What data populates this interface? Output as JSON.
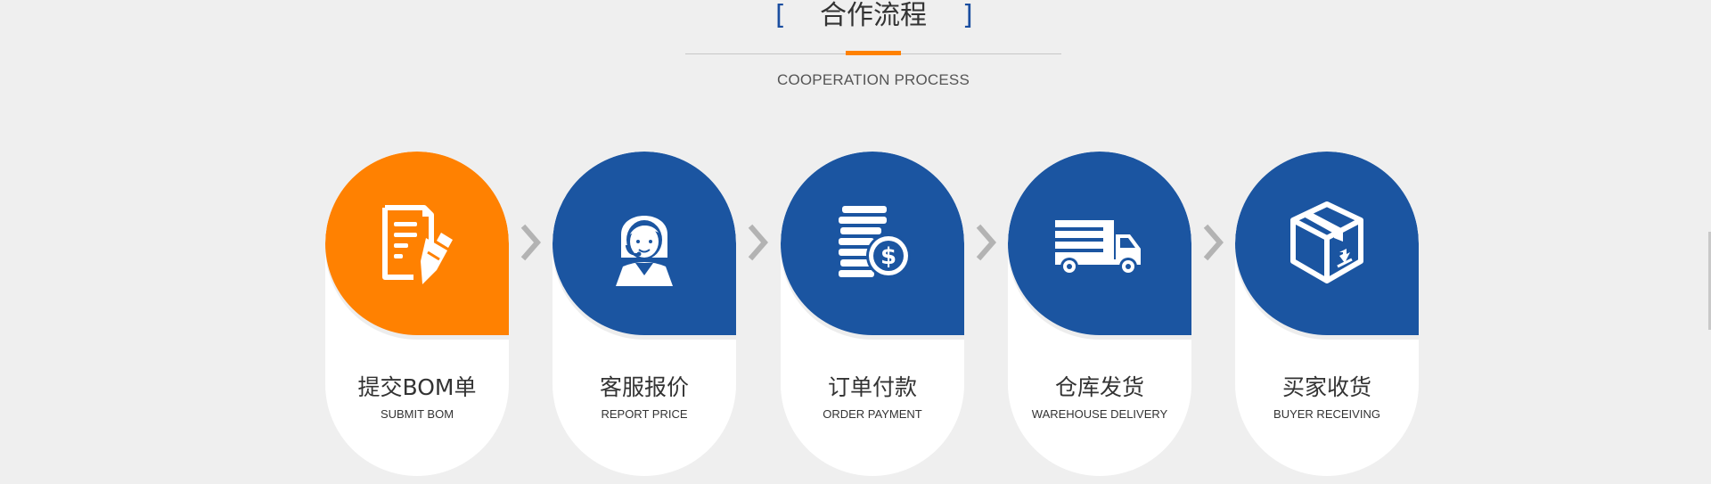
{
  "header": {
    "bracket_left": "[",
    "title": "合作流程",
    "bracket_right": "]",
    "subtitle": "COOPERATION PROCESS"
  },
  "colors": {
    "accent_orange": "#ff8101",
    "brand_blue": "#1b55a1",
    "arrow_gray": "#b3b3b3"
  },
  "steps": [
    {
      "label_cn": "提交BOM单",
      "label_en": "SUBMIT BOM",
      "icon": "document-pen-icon",
      "color": "#ff8101"
    },
    {
      "label_cn": "客服报价",
      "label_en": "REPORT PRICE",
      "icon": "customer-service-agent-icon",
      "color": "#1b55a1"
    },
    {
      "label_cn": "订单付款",
      "label_en": "ORDER PAYMENT",
      "icon": "coins-dollar-icon",
      "color": "#1b55a1"
    },
    {
      "label_cn": "仓库发货",
      "label_en": "WAREHOUSE DELIVERY",
      "icon": "delivery-truck-icon",
      "color": "#1b55a1"
    },
    {
      "label_cn": "买家收货",
      "label_en": "BUYER RECEIVING",
      "icon": "package-box-icon",
      "color": "#1b55a1"
    }
  ]
}
